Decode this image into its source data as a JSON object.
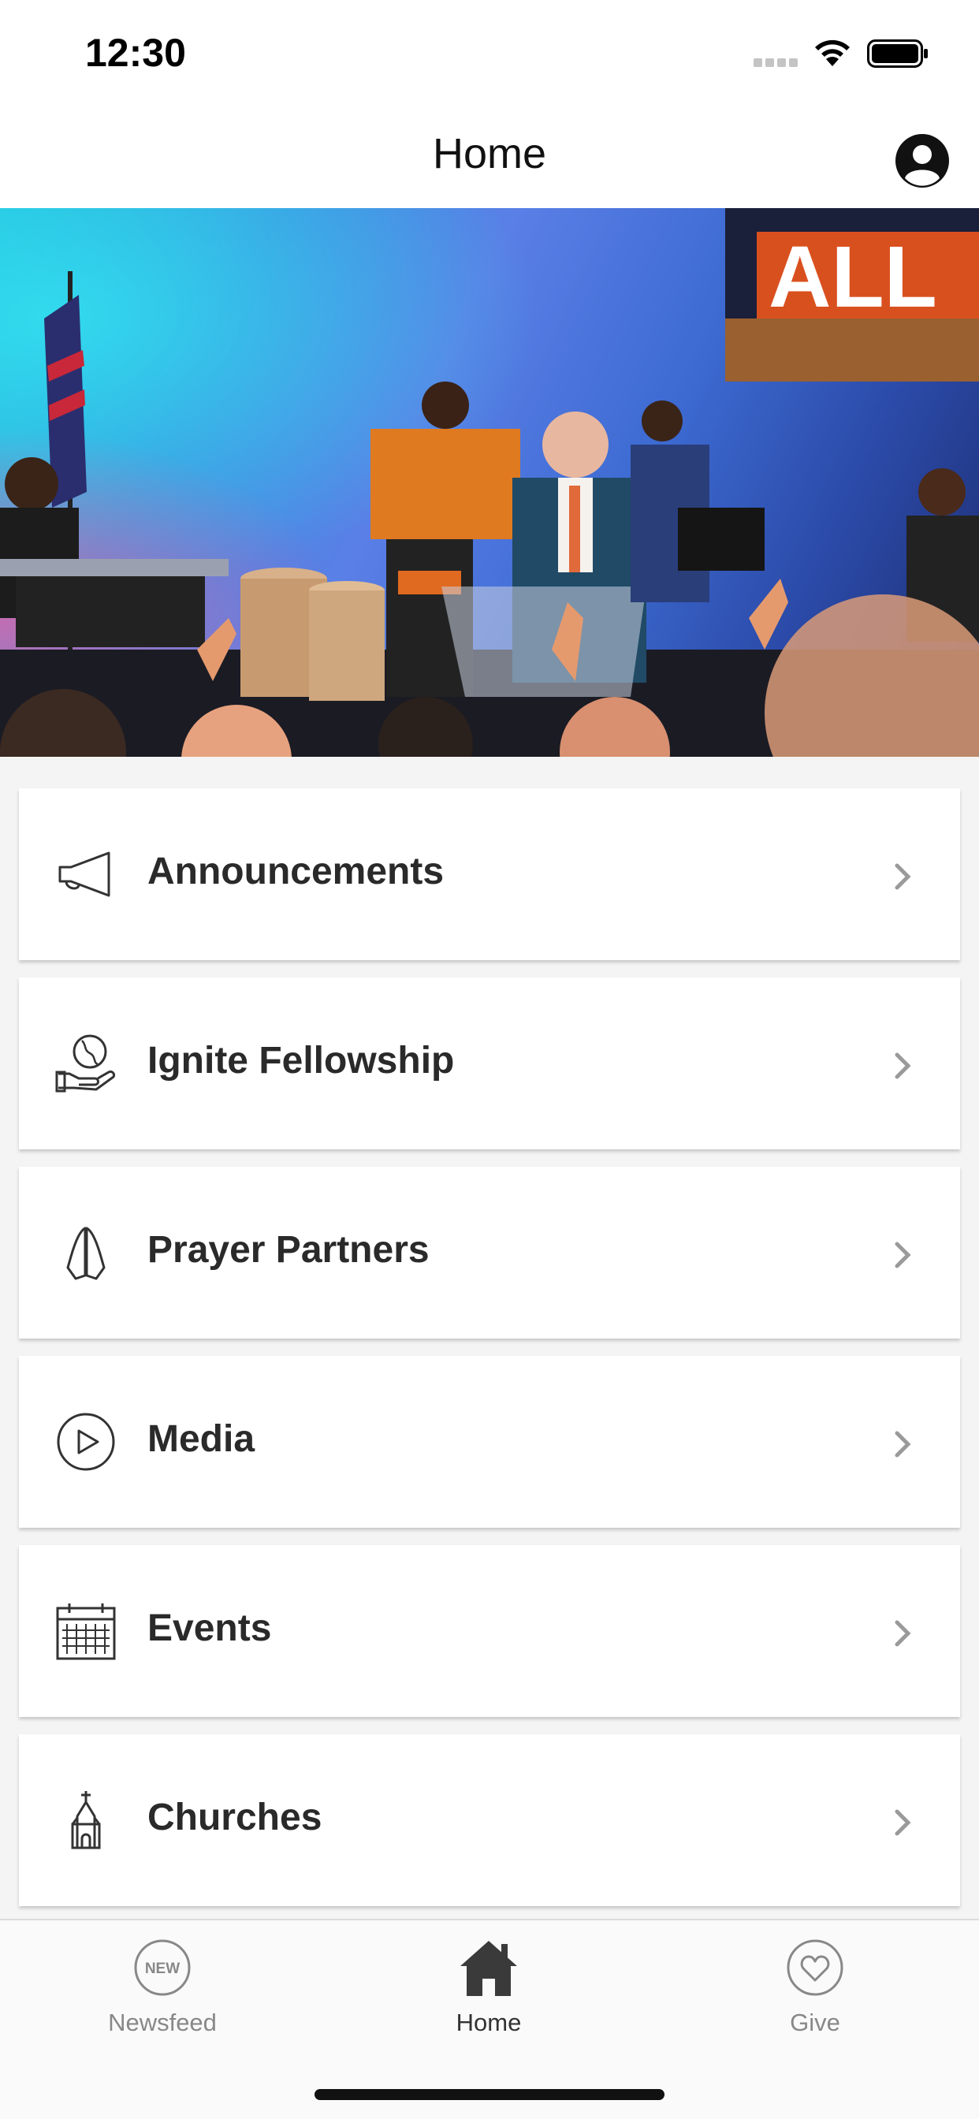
{
  "status_bar": {
    "time": "12:30"
  },
  "header": {
    "title": "Home",
    "profile_icon": "person-circle-icon"
  },
  "hero": {
    "description_icon": "worship-stage-photo"
  },
  "menu": {
    "items": [
      {
        "label": "Announcements",
        "icon": "megaphone-icon"
      },
      {
        "label": "Ignite Fellowship",
        "icon": "globe-hand-icon"
      },
      {
        "label": "Prayer Partners",
        "icon": "praying-hands-icon"
      },
      {
        "label": "Media",
        "icon": "play-circle-icon"
      },
      {
        "label": "Events",
        "icon": "calendar-icon"
      },
      {
        "label": "Churches",
        "icon": "church-icon"
      }
    ]
  },
  "tab_bar": {
    "tabs": [
      {
        "label": "Newsfeed",
        "icon": "new-badge-icon",
        "badge": "NEW"
      },
      {
        "label": "Home",
        "icon": "house-icon"
      },
      {
        "label": "Give",
        "icon": "heart-circle-icon"
      }
    ],
    "active": "Home"
  },
  "colors": {
    "background": "#f4f4f4",
    "card": "#ffffff",
    "text": "#2a2a2a",
    "chevron": "#9a9a9a",
    "tab_inactive": "#888888"
  }
}
